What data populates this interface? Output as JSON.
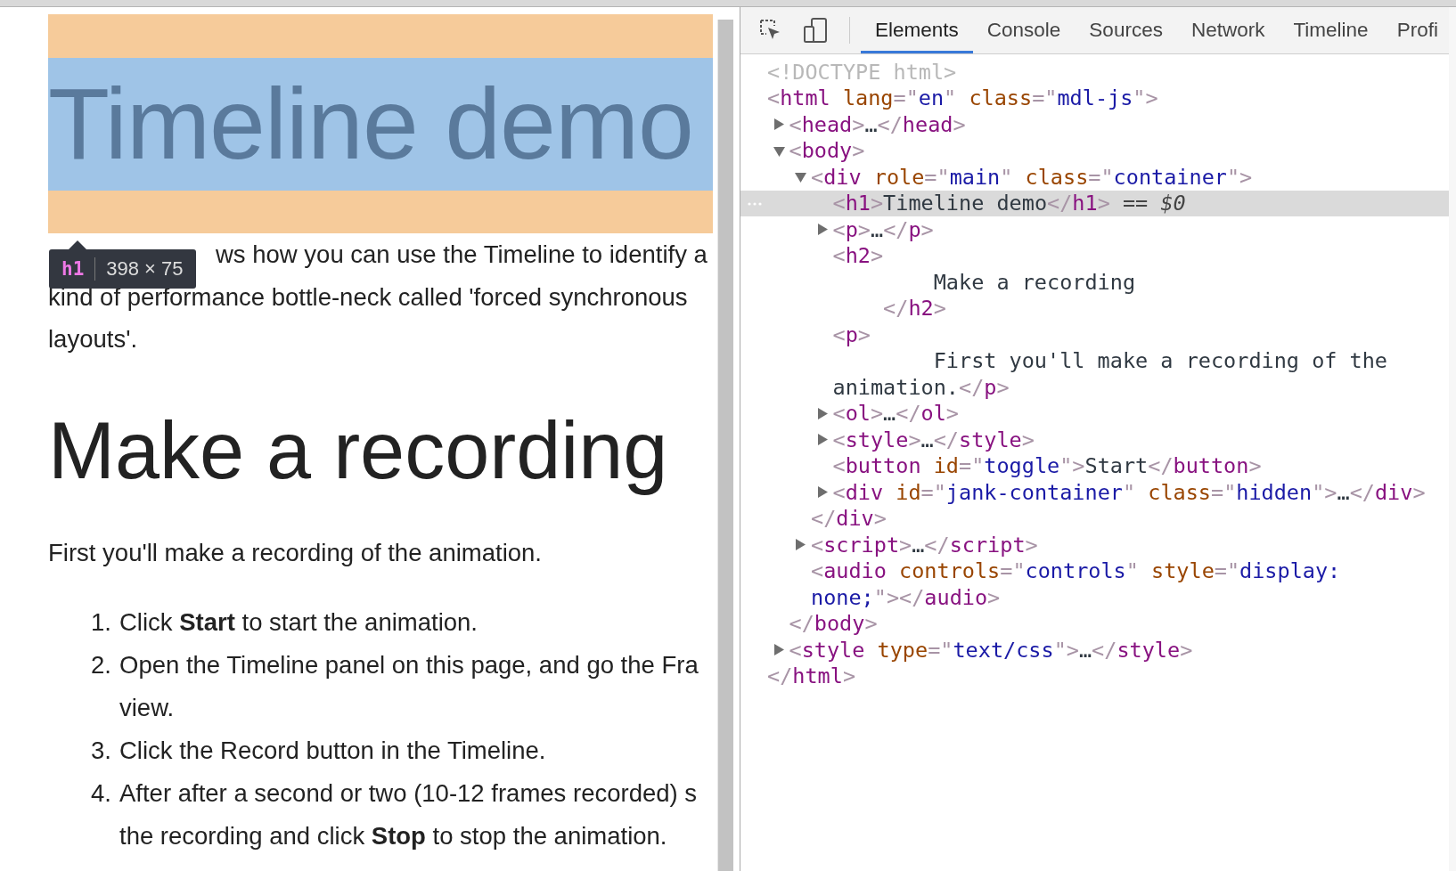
{
  "page": {
    "h1": "Timeline demo",
    "tooltip": {
      "tag": "h1",
      "size": "398 × 75"
    },
    "intro_lines": [
      "ws how you can use the Timeline to identify a",
      "kind of performance bottle-neck called 'forced synchronous",
      "layouts'."
    ],
    "h2": "Make a recording",
    "paragraph": "First you'll make a recording of the animation.",
    "steps": [
      {
        "number": "1.",
        "lines": [
          "Click **Start** to start the animation."
        ]
      },
      {
        "number": "2.",
        "lines": [
          "Open the Timeline panel on this page, and go the Fra",
          "view."
        ]
      },
      {
        "number": "3.",
        "lines": [
          "Click the Record button in the Timeline."
        ]
      },
      {
        "number": "4.",
        "lines": [
          "After after a second or two (10-12 frames recorded) s",
          "the recording and click **Stop** to stop the animation."
        ]
      }
    ]
  },
  "devtools": {
    "tabs": [
      {
        "label": "Elements",
        "selected": true
      },
      {
        "label": "Console",
        "selected": false
      },
      {
        "label": "Sources",
        "selected": false
      },
      {
        "label": "Network",
        "selected": false
      },
      {
        "label": "Timeline",
        "selected": false
      },
      {
        "label": "Profi",
        "selected": false
      }
    ],
    "tree": [
      {
        "selected": false,
        "lines": [
          [
            {
              "kind": "doctype",
              "text": "<!DOCTYPE html>"
            }
          ]
        ]
      },
      {
        "selected": false,
        "lines": [
          [
            {
              "kind": "punct",
              "text": "<"
            },
            {
              "kind": "tag",
              "text": "html"
            },
            {
              "kind": "attr",
              "text": " lang"
            },
            {
              "kind": "punct",
              "text": "=\""
            },
            {
              "kind": "value",
              "text": "en"
            },
            {
              "kind": "punct",
              "text": "\""
            },
            {
              "kind": "attr",
              "text": " class"
            },
            {
              "kind": "punct",
              "text": "=\""
            },
            {
              "kind": "value",
              "text": "mdl-js"
            },
            {
              "kind": "punct",
              "text": "\">"
            }
          ]
        ],
        "close": [
          {
            "kind": "punct",
            "text": "</"
          },
          {
            "kind": "tag",
            "text": "html"
          },
          {
            "kind": "punct",
            "text": ">"
          }
        ],
        "children": [
          {
            "selected": false,
            "expanded": false,
            "lines": [
              [
                {
                  "kind": "punct",
                  "text": "<"
                },
                {
                  "kind": "tag",
                  "text": "head"
                },
                {
                  "kind": "punct",
                  "text": ">"
                },
                {
                  "kind": "text",
                  "text": "…"
                },
                {
                  "kind": "punct",
                  "text": "</"
                },
                {
                  "kind": "tag",
                  "text": "head"
                },
                {
                  "kind": "punct",
                  "text": ">"
                }
              ]
            ]
          },
          {
            "selected": false,
            "expanded": true,
            "lines": [
              [
                {
                  "kind": "punct",
                  "text": "<"
                },
                {
                  "kind": "tag",
                  "text": "body"
                },
                {
                  "kind": "punct",
                  "text": ">"
                }
              ]
            ],
            "close": [
              {
                "kind": "punct",
                "text": "</"
              },
              {
                "kind": "tag",
                "text": "body"
              },
              {
                "kind": "punct",
                "text": ">"
              }
            ],
            "children": [
              {
                "selected": false,
                "expanded": true,
                "lines": [
                  [
                    {
                      "kind": "punct",
                      "text": "<"
                    },
                    {
                      "kind": "tag",
                      "text": "div"
                    },
                    {
                      "kind": "attr",
                      "text": " role"
                    },
                    {
                      "kind": "punct",
                      "text": "=\""
                    },
                    {
                      "kind": "value",
                      "text": "main"
                    },
                    {
                      "kind": "punct",
                      "text": "\""
                    },
                    {
                      "kind": "attr",
                      "text": " class"
                    },
                    {
                      "kind": "punct",
                      "text": "=\""
                    },
                    {
                      "kind": "value",
                      "text": "container"
                    },
                    {
                      "kind": "punct",
                      "text": "\">"
                    }
                  ]
                ],
                "close": [
                  {
                    "kind": "punct",
                    "text": "</"
                  },
                  {
                    "kind": "tag",
                    "text": "div"
                  },
                  {
                    "kind": "punct",
                    "text": ">"
                  }
                ],
                "children": [
                  {
                    "selected": true,
                    "lines": [
                      [
                        {
                          "kind": "punct",
                          "text": "<"
                        },
                        {
                          "kind": "tag",
                          "text": "h1"
                        },
                        {
                          "kind": "punct",
                          "text": ">"
                        },
                        {
                          "kind": "text",
                          "text": "Timeline demo"
                        },
                        {
                          "kind": "punct",
                          "text": "</"
                        },
                        {
                          "kind": "tag",
                          "text": "h1"
                        },
                        {
                          "kind": "punct",
                          "text": ">"
                        },
                        {
                          "kind": "ref",
                          "text": " == "
                        },
                        {
                          "kind": "var",
                          "text": "$0"
                        }
                      ]
                    ]
                  },
                  {
                    "selected": false,
                    "expanded": false,
                    "lines": [
                      [
                        {
                          "kind": "punct",
                          "text": "<"
                        },
                        {
                          "kind": "tag",
                          "text": "p"
                        },
                        {
                          "kind": "punct",
                          "text": ">"
                        },
                        {
                          "kind": "text",
                          "text": "…"
                        },
                        {
                          "kind": "punct",
                          "text": "</"
                        },
                        {
                          "kind": "tag",
                          "text": "p"
                        },
                        {
                          "kind": "punct",
                          "text": ">"
                        }
                      ]
                    ]
                  },
                  {
                    "selected": false,
                    "lines": [
                      [
                        {
                          "kind": "punct",
                          "text": "<"
                        },
                        {
                          "kind": "tag",
                          "text": "h2"
                        },
                        {
                          "kind": "punct",
                          "text": ">"
                        }
                      ],
                      [
                        {
                          "kind": "text",
                          "text": "        Make a recording"
                        }
                      ],
                      [
                        {
                          "kind": "punct",
                          "text": "    </"
                        },
                        {
                          "kind": "tag",
                          "text": "h2"
                        },
                        {
                          "kind": "punct",
                          "text": ">"
                        }
                      ]
                    ]
                  },
                  {
                    "selected": false,
                    "lines": [
                      [
                        {
                          "kind": "punct",
                          "text": "<"
                        },
                        {
                          "kind": "tag",
                          "text": "p"
                        },
                        {
                          "kind": "punct",
                          "text": ">"
                        }
                      ],
                      [
                        {
                          "kind": "text",
                          "text": "        First you'll make a recording of the"
                        }
                      ],
                      [
                        {
                          "kind": "text",
                          "text": "animation."
                        },
                        {
                          "kind": "punct",
                          "text": "</"
                        },
                        {
                          "kind": "tag",
                          "text": "p"
                        },
                        {
                          "kind": "punct",
                          "text": ">"
                        }
                      ]
                    ]
                  },
                  {
                    "selected": false,
                    "expanded": false,
                    "lines": [
                      [
                        {
                          "kind": "punct",
                          "text": "<"
                        },
                        {
                          "kind": "tag",
                          "text": "ol"
                        },
                        {
                          "kind": "punct",
                          "text": ">"
                        },
                        {
                          "kind": "text",
                          "text": "…"
                        },
                        {
                          "kind": "punct",
                          "text": "</"
                        },
                        {
                          "kind": "tag",
                          "text": "ol"
                        },
                        {
                          "kind": "punct",
                          "text": ">"
                        }
                      ]
                    ]
                  },
                  {
                    "selected": false,
                    "expanded": false,
                    "lines": [
                      [
                        {
                          "kind": "punct",
                          "text": "<"
                        },
                        {
                          "kind": "tag",
                          "text": "style"
                        },
                        {
                          "kind": "punct",
                          "text": ">"
                        },
                        {
                          "kind": "text",
                          "text": "…"
                        },
                        {
                          "kind": "punct",
                          "text": "</"
                        },
                        {
                          "kind": "tag",
                          "text": "style"
                        },
                        {
                          "kind": "punct",
                          "text": ">"
                        }
                      ]
                    ]
                  },
                  {
                    "selected": false,
                    "lines": [
                      [
                        {
                          "kind": "punct",
                          "text": "<"
                        },
                        {
                          "kind": "tag",
                          "text": "button"
                        },
                        {
                          "kind": "attr",
                          "text": " id"
                        },
                        {
                          "kind": "punct",
                          "text": "=\""
                        },
                        {
                          "kind": "value",
                          "text": "toggle"
                        },
                        {
                          "kind": "punct",
                          "text": "\">"
                        },
                        {
                          "kind": "text",
                          "text": "Start"
                        },
                        {
                          "kind": "punct",
                          "text": "</"
                        },
                        {
                          "kind": "tag",
                          "text": "button"
                        },
                        {
                          "kind": "punct",
                          "text": ">"
                        }
                      ]
                    ]
                  },
                  {
                    "selected": false,
                    "expanded": false,
                    "lines": [
                      [
                        {
                          "kind": "punct",
                          "text": "<"
                        },
                        {
                          "kind": "tag",
                          "text": "div"
                        },
                        {
                          "kind": "attr",
                          "text": " id"
                        },
                        {
                          "kind": "punct",
                          "text": "=\""
                        },
                        {
                          "kind": "value",
                          "text": "jank-container"
                        },
                        {
                          "kind": "punct",
                          "text": "\""
                        },
                        {
                          "kind": "attr",
                          "text": " class"
                        },
                        {
                          "kind": "punct",
                          "text": "=\""
                        },
                        {
                          "kind": "value",
                          "text": "hidden"
                        },
                        {
                          "kind": "punct",
                          "text": "\">"
                        },
                        {
                          "kind": "text",
                          "text": "…"
                        },
                        {
                          "kind": "punct",
                          "text": "</"
                        },
                        {
                          "kind": "tag",
                          "text": "div"
                        },
                        {
                          "kind": "punct",
                          "text": ">"
                        }
                      ]
                    ]
                  }
                ]
              },
              {
                "selected": false,
                "expanded": false,
                "lines": [
                  [
                    {
                      "kind": "punct",
                      "text": "<"
                    },
                    {
                      "kind": "tag",
                      "text": "script"
                    },
                    {
                      "kind": "punct",
                      "text": ">"
                    },
                    {
                      "kind": "text",
                      "text": "…"
                    },
                    {
                      "kind": "punct",
                      "text": "</"
                    },
                    {
                      "kind": "tag",
                      "text": "script"
                    },
                    {
                      "kind": "punct",
                      "text": ">"
                    }
                  ]
                ]
              },
              {
                "selected": false,
                "lines": [
                  [
                    {
                      "kind": "punct",
                      "text": "<"
                    },
                    {
                      "kind": "tag",
                      "text": "audio"
                    },
                    {
                      "kind": "attr",
                      "text": " controls"
                    },
                    {
                      "kind": "punct",
                      "text": "=\""
                    },
                    {
                      "kind": "value",
                      "text": "controls"
                    },
                    {
                      "kind": "punct",
                      "text": "\""
                    },
                    {
                      "kind": "attr",
                      "text": " style"
                    },
                    {
                      "kind": "punct",
                      "text": "=\""
                    },
                    {
                      "kind": "value",
                      "text": "display:"
                    }
                  ],
                  [
                    {
                      "kind": "value",
                      "text": "none;"
                    },
                    {
                      "kind": "punct",
                      "text": "\"></"
                    },
                    {
                      "kind": "tag",
                      "text": "audio"
                    },
                    {
                      "kind": "punct",
                      "text": ">"
                    }
                  ]
                ]
              }
            ]
          },
          {
            "selected": false,
            "expanded": false,
            "lines": [
              [
                {
                  "kind": "punct",
                  "text": "<"
                },
                {
                  "kind": "tag",
                  "text": "style"
                },
                {
                  "kind": "attr",
                  "text": " type"
                },
                {
                  "kind": "punct",
                  "text": "=\""
                },
                {
                  "kind": "value",
                  "text": "text/css"
                },
                {
                  "kind": "punct",
                  "text": "\">"
                },
                {
                  "kind": "text",
                  "text": "…"
                },
                {
                  "kind": "punct",
                  "text": "</"
                },
                {
                  "kind": "tag",
                  "text": "style"
                },
                {
                  "kind": "punct",
                  "text": ">"
                }
              ]
            ]
          }
        ]
      }
    ]
  }
}
